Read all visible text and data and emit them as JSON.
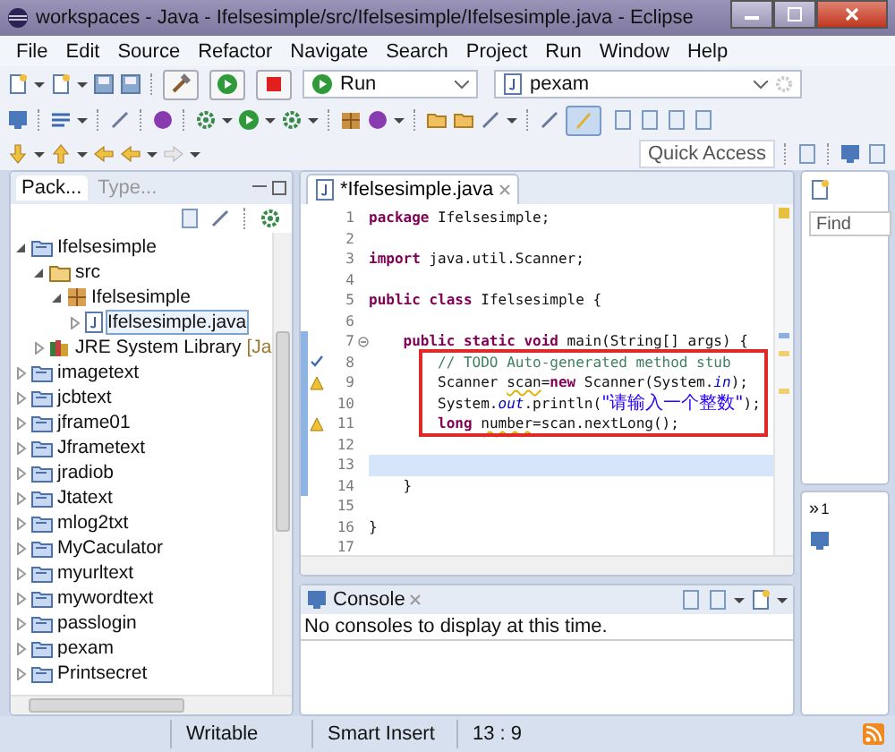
{
  "window": {
    "title": "workspaces - Java - Ifelsesimple/src/Ifelsesimple/Ifelsesimple.java - Eclipse"
  },
  "menu": [
    "File",
    "Edit",
    "Source",
    "Refactor",
    "Navigate",
    "Search",
    "Project",
    "Run",
    "Window",
    "Help"
  ],
  "toolbar": {
    "run_config": "Run",
    "project": "pexam",
    "quick_access": "Quick Access"
  },
  "package_explorer": {
    "tabs": [
      {
        "label": "Pack...",
        "selected": true
      },
      {
        "label": "Type...",
        "selected": false
      }
    ],
    "tree": [
      {
        "label": "Ifelsesimple",
        "kind": "project",
        "expanded": true,
        "selected": false,
        "children": [
          {
            "label": "src",
            "kind": "folder",
            "expanded": true,
            "selected": false,
            "children": [
              {
                "label": "Ifelsesimple",
                "kind": "package",
                "expanded": true,
                "selected": false,
                "children": [
                  {
                    "label": "Ifelsesimple.java",
                    "kind": "file",
                    "expanded": false,
                    "selected": true
                  }
                ]
              }
            ]
          },
          {
            "label": "JRE System Library",
            "decoration": "[Ja",
            "kind": "library",
            "expanded": false,
            "selected": false
          }
        ]
      },
      {
        "label": "imagetext",
        "kind": "project",
        "expanded": false,
        "selected": false
      },
      {
        "label": "jcbtext",
        "kind": "project",
        "expanded": false,
        "selected": false
      },
      {
        "label": "jframe01",
        "kind": "project",
        "expanded": false,
        "selected": false
      },
      {
        "label": "Jframetext",
        "kind": "project",
        "expanded": false,
        "selected": false
      },
      {
        "label": "jradiob",
        "kind": "project",
        "expanded": false,
        "selected": false
      },
      {
        "label": "Jtatext",
        "kind": "project",
        "expanded": false,
        "selected": false
      },
      {
        "label": "mlog2txt",
        "kind": "project",
        "expanded": false,
        "selected": false
      },
      {
        "label": "MyCaculator",
        "kind": "project",
        "expanded": false,
        "selected": false
      },
      {
        "label": "myurltext",
        "kind": "project",
        "expanded": false,
        "selected": false
      },
      {
        "label": "mywordtext",
        "kind": "project",
        "expanded": false,
        "selected": false
      },
      {
        "label": "passlogin",
        "kind": "project",
        "expanded": false,
        "selected": false
      },
      {
        "label": "pexam",
        "kind": "project",
        "expanded": false,
        "selected": false
      },
      {
        "label": "Printsecret",
        "kind": "project",
        "expanded": false,
        "selected": false
      }
    ]
  },
  "editor": {
    "tab": "*Ifelsesimple.java",
    "lines": [
      {
        "number": "1",
        "changed": false,
        "current": false,
        "tokens": [
          {
            "kind": "keyword",
            "text": "package "
          },
          {
            "kind": "plain",
            "text": "Ifelsesimple;"
          }
        ]
      },
      {
        "number": "2",
        "changed": false,
        "current": false
      },
      {
        "number": "3",
        "changed": false,
        "current": false,
        "tokens": [
          {
            "kind": "keyword",
            "text": "import "
          },
          {
            "kind": "plain",
            "text": "java.util.Scanner;"
          }
        ]
      },
      {
        "number": "4",
        "changed": false,
        "current": false
      },
      {
        "number": "5",
        "changed": false,
        "current": false,
        "tokens": [
          {
            "kind": "keyword",
            "text": "public class "
          },
          {
            "kind": "plain",
            "text": "Ifelsesimple {"
          }
        ]
      },
      {
        "number": "6",
        "changed": false,
        "current": false
      },
      {
        "number": "7",
        "marker": {
          "kind": "fold"
        },
        "changed": true,
        "current": false,
        "tokens": [
          {
            "kind": "keyword",
            "text": "    public static void "
          },
          {
            "kind": "plain",
            "text": "main(String[] args) {"
          }
        ]
      },
      {
        "number": "8",
        "marker": {
          "kind": "task"
        },
        "changed": true,
        "current": false,
        "tokens": [
          {
            "kind": "comment",
            "text": "        // TODO Auto-generated method stub"
          }
        ]
      },
      {
        "number": "9",
        "marker": {
          "kind": "warning"
        },
        "changed": true,
        "current": false,
        "tokens": [
          {
            "kind": "plain",
            "text": "        Scanner "
          },
          {
            "kind": "warned",
            "text": "scan"
          },
          {
            "kind": "plain",
            "text": "="
          },
          {
            "kind": "keyword",
            "text": "new"
          },
          {
            "kind": "plain",
            "text": " Scanner(System."
          },
          {
            "kind": "field",
            "text": "in"
          },
          {
            "kind": "plain",
            "text": ");"
          }
        ]
      },
      {
        "number": "10",
        "changed": true,
        "current": false,
        "tokens": [
          {
            "kind": "plain",
            "text": "        System."
          },
          {
            "kind": "field",
            "text": "out"
          },
          {
            "kind": "plain",
            "text": ".println("
          },
          {
            "kind": "string",
            "text": "\"请输入一个整数\""
          },
          {
            "kind": "plain",
            "text": ");"
          }
        ]
      },
      {
        "number": "11",
        "marker": {
          "kind": "warning"
        },
        "changed": true,
        "current": false,
        "tokens": [
          {
            "kind": "keyword",
            "text": "        long "
          },
          {
            "kind": "warned",
            "text": "number"
          },
          {
            "kind": "plain",
            "text": "=scan.nextLong();"
          }
        ]
      },
      {
        "number": "12",
        "changed": true,
        "current": false
      },
      {
        "number": "13",
        "changed": true,
        "current": true
      },
      {
        "number": "14",
        "changed": true,
        "current": false,
        "tokens": [
          {
            "kind": "plain",
            "text": "    }"
          }
        ]
      },
      {
        "number": "15",
        "changed": false,
        "current": false
      },
      {
        "number": "16",
        "changed": false,
        "current": false,
        "tokens": [
          {
            "kind": "plain",
            "text": "}"
          }
        ]
      },
      {
        "number": "17",
        "changed": false,
        "current": false
      }
    ]
  },
  "right_panel": {
    "find_placeholder": "Find",
    "overflow": "»",
    "overflow_count": "1"
  },
  "console": {
    "title": "Console",
    "message": "No consoles to display at this time."
  },
  "status_bar": [
    "Writable",
    "Smart Insert",
    "13 : 9"
  ]
}
